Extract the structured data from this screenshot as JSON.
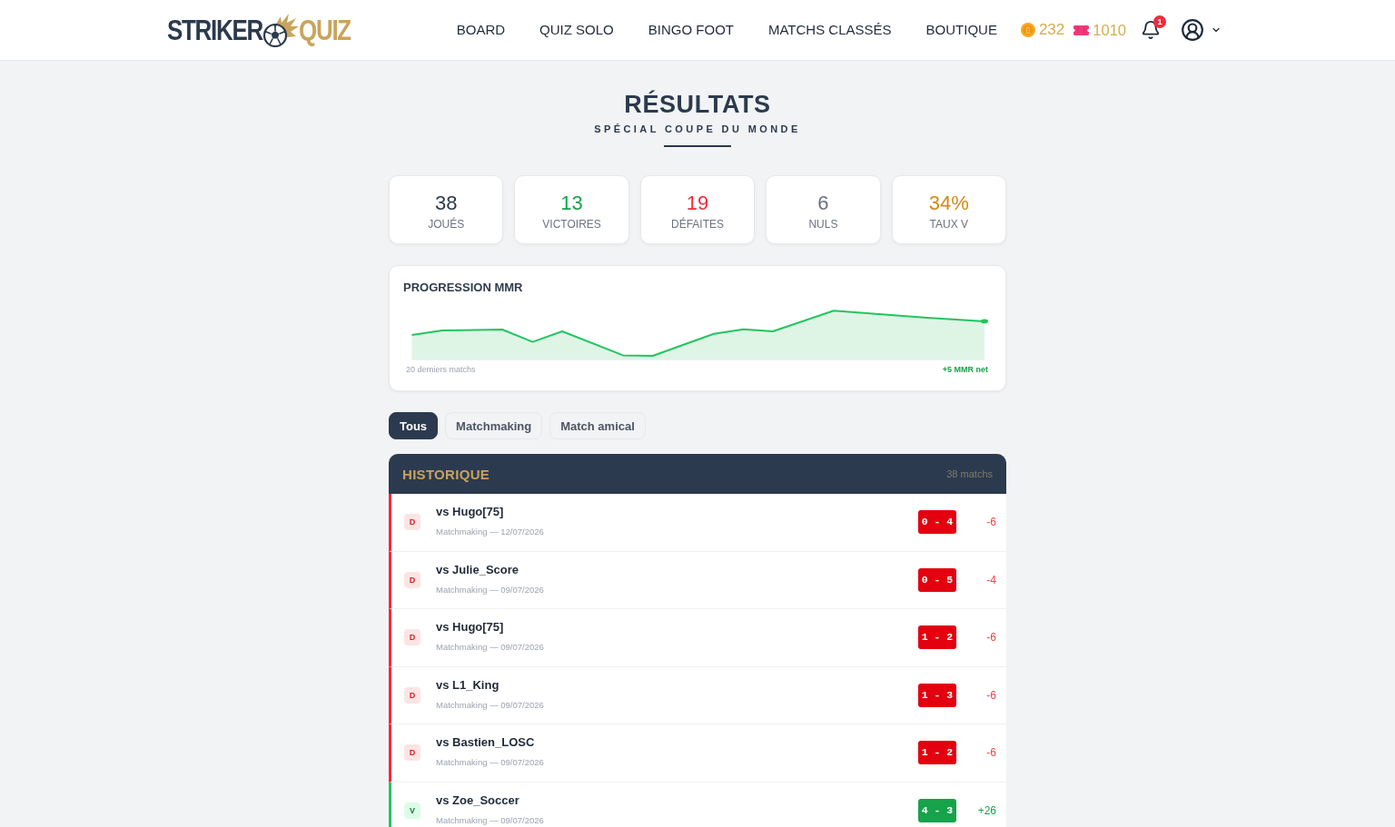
{
  "header": {
    "logo": {
      "word_1": "STRIKER",
      "word_2": "QUIZ"
    },
    "nav": [
      {
        "label": "BOARD"
      },
      {
        "label": "QUIZ SOLO"
      },
      {
        "label": "BINGO FOOT"
      },
      {
        "label": "MATCHS CLASSÉS"
      },
      {
        "label": "BOUTIQUE"
      }
    ],
    "wallet": {
      "coins": "232",
      "tickets": "1010"
    },
    "notifications": {
      "count": "1"
    }
  },
  "page": {
    "title": "RÉSULTATS",
    "subtitle": "SPÉCIAL COUPE DU MONDE"
  },
  "stats": [
    {
      "value": "38",
      "label": "JOUÉS",
      "color": "#2b3a4d"
    },
    {
      "value": "13",
      "label": "VICTOIRES",
      "color": "#16a34a"
    },
    {
      "value": "19",
      "label": "DÉFAITES",
      "color": "#ef2b3b"
    },
    {
      "value": "6",
      "label": "NULS",
      "color": "#6b7280"
    },
    {
      "value": "34%",
      "label": "TAUX V",
      "color": "#d4890f"
    }
  ],
  "mmr_progress": {
    "title": "PROGRESSION MMR",
    "caption": "20 derniers matchs",
    "net": "+5 MMR net"
  },
  "filters": [
    {
      "label": "Tous",
      "selected": true
    },
    {
      "label": "Matchmaking",
      "selected": false
    },
    {
      "label": "Match amical",
      "selected": false
    }
  ],
  "history": {
    "title": "HISTORIQUE",
    "count": "38 matchs",
    "rows": [
      {
        "kind": "loss",
        "letter": "D",
        "opponent": "vs Hugo[75]",
        "meta": "Matchmaking — 12/07/2026",
        "score": "0 - 4",
        "mmr": "-6"
      },
      {
        "kind": "loss",
        "letter": "D",
        "opponent": "vs Julie_Score",
        "meta": "Matchmaking — 09/07/2026",
        "score": "0 - 5",
        "mmr": "-4"
      },
      {
        "kind": "loss",
        "letter": "D",
        "opponent": "vs Hugo[75]",
        "meta": "Matchmaking — 09/07/2026",
        "score": "1 - 2",
        "mmr": "-6"
      },
      {
        "kind": "loss",
        "letter": "D",
        "opponent": "vs L1_King",
        "meta": "Matchmaking — 09/07/2026",
        "score": "1 - 3",
        "mmr": "-6"
      },
      {
        "kind": "loss",
        "letter": "D",
        "opponent": "vs Bastien_LOSC",
        "meta": "Matchmaking — 09/07/2026",
        "score": "1 - 2",
        "mmr": "-6"
      },
      {
        "kind": "win",
        "letter": "V",
        "opponent": "vs Zoe_Soccer",
        "meta": "Matchmaking — 09/07/2026",
        "score": "4 - 3",
        "mmr": "+26"
      }
    ]
  }
}
